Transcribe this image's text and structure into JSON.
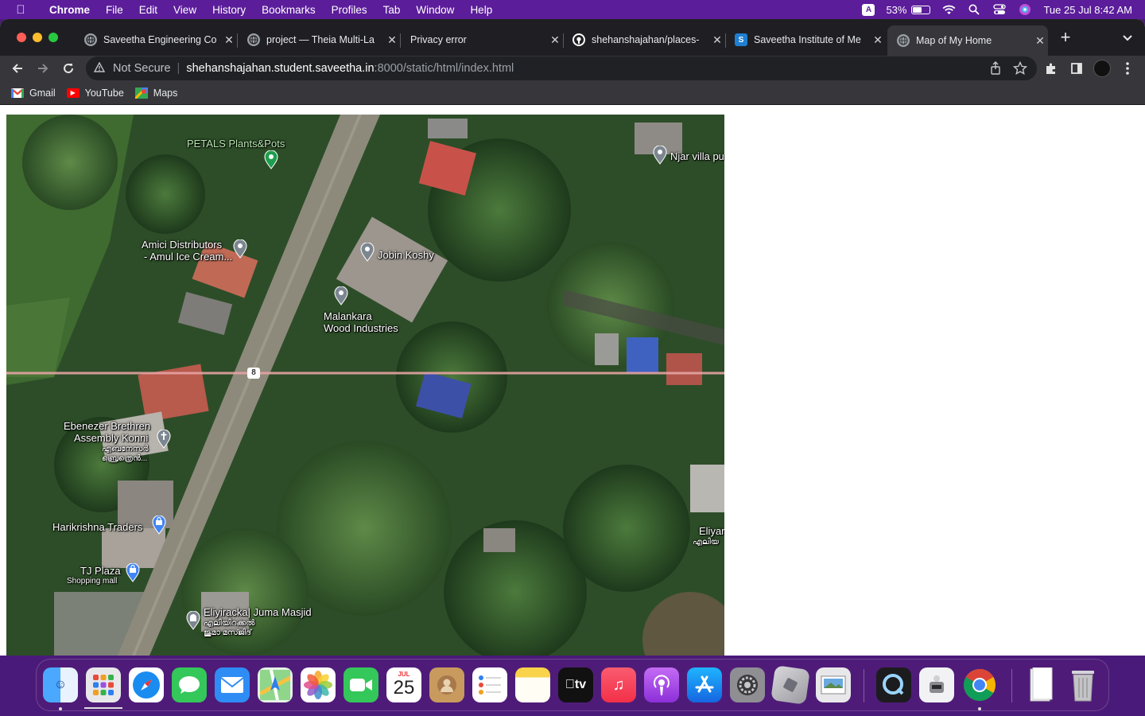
{
  "menubar": {
    "app": "Chrome",
    "items": [
      "File",
      "Edit",
      "View",
      "History",
      "Bookmarks",
      "Profiles",
      "Tab",
      "Window",
      "Help"
    ],
    "input_source": "A",
    "battery": "53%",
    "datetime": "Tue 25 Jul  8:42 AM"
  },
  "tabs": [
    {
      "title": "Saveetha Engineering Co",
      "favicon": "globe-icon"
    },
    {
      "title": "project — Theia Multi-La",
      "favicon": "globe-icon"
    },
    {
      "title": "Privacy error",
      "favicon": "none"
    },
    {
      "title": "shehanshajahan/places-",
      "favicon": "github-icon"
    },
    {
      "title": "Saveetha Institute of Me",
      "favicon": "s-icon"
    },
    {
      "title": "Map of My Home",
      "favicon": "globe-icon",
      "active": true
    }
  ],
  "omnibox": {
    "security": "Not Secure",
    "host": "shehanshajahan.student.saveetha.in",
    "path": ":8000/static/html/index.html"
  },
  "bookmarks": [
    "Gmail",
    "YouTube",
    "Maps"
  ],
  "map": {
    "road_shield": "8",
    "places": [
      {
        "name": "PETALS Plants&Pots"
      },
      {
        "name": "Njar villa pu"
      },
      {
        "name": "Amici Distributors",
        "line2": "- Amul Ice Cream..."
      },
      {
        "name": "Jobin Koshy"
      },
      {
        "name": "Malankara",
        "line2": "Wood Industries"
      },
      {
        "name": "Ebenezer Brethren",
        "line2": "Assembly Konni",
        "local1": "എബനേസർ",
        "local2": "ബ്രെത്രെൻ..."
      },
      {
        "name": "Harikrishna Traders"
      },
      {
        "name": "TJ Plaza",
        "sub": "Shopping mall"
      },
      {
        "name": "Eliyiracka| Juma Masjid",
        "local1": "എലിയിറക്കൽ",
        "local2": "ജുമാ മസ്ജിദ്"
      },
      {
        "name": "Eliyar",
        "local1": "എലിയ"
      }
    ]
  },
  "dock": {
    "calendar_month": "JUL",
    "calendar_day": "25",
    "tv_label": "tv",
    "apps": [
      "Finder",
      "Launchpad",
      "Safari",
      "Messages",
      "Mail",
      "Maps",
      "Photos",
      "FaceTime",
      "Calendar",
      "Contacts",
      "Reminders",
      "Notes",
      "TV",
      "Music",
      "Podcasts",
      "App Store",
      "System Settings",
      "Screen Sharing",
      "Preview",
      "QuickTime Player",
      "Automator",
      "Google Chrome",
      "Documents",
      "Trash"
    ]
  }
}
